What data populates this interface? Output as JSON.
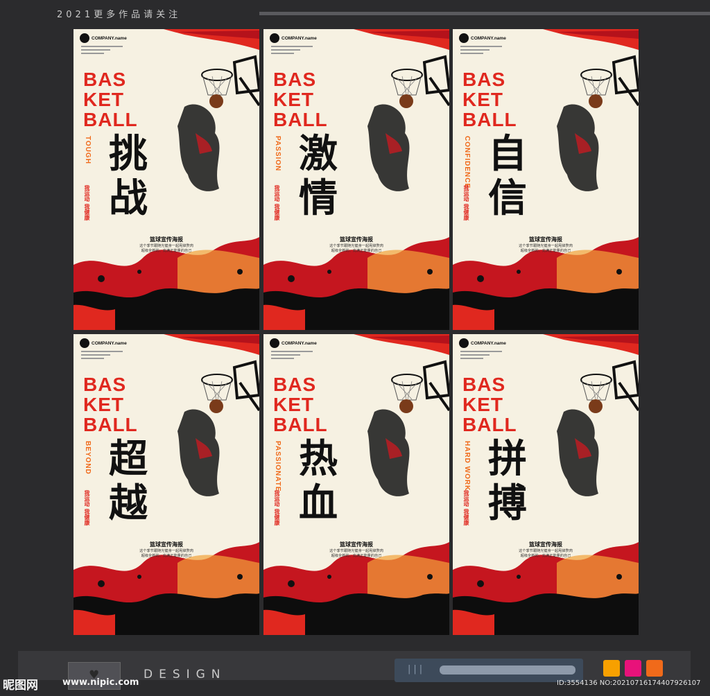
{
  "header": {
    "text": "2021更多作品请关注"
  },
  "brand": {
    "company": "COMPANY.name"
  },
  "posters": [
    {
      "big": [
        "BAS",
        "KET",
        "BALL"
      ],
      "vertical": "TOUGH",
      "chinese": "挑战",
      "vert_cn": "我运动 我健康",
      "subtitle": "篮球宣传海报",
      "desc1": "这个季节跟随光健身一起甩掉赘肉",
      "desc2": "超级全新的、充满正能量的自己"
    },
    {
      "big": [
        "BAS",
        "KET",
        "BALL"
      ],
      "vertical": "PASSION",
      "chinese": "激情",
      "vert_cn": "我运动 我健康",
      "subtitle": "篮球宣传海报",
      "desc1": "这个季节跟随光健身一起甩掉赘肉",
      "desc2": "超级全新的、充满正能量的自己"
    },
    {
      "big": [
        "BAS",
        "KET",
        "BALL"
      ],
      "vertical": "CONFIDENCE",
      "chinese": "自信",
      "vert_cn": "我运动 我健康",
      "subtitle": "篮球宣传海报",
      "desc1": "这个季节跟随光健身一起甩掉赘肉",
      "desc2": "超级全新的、充满正能量的自己"
    },
    {
      "big": [
        "BAS",
        "KET",
        "BALL"
      ],
      "vertical": "BEYOND",
      "chinese": "超越",
      "vert_cn": "我运动 我健康",
      "subtitle": "篮球宣传海报",
      "desc1": "这个季节跟随光健身一起甩掉赘肉",
      "desc2": "超级全新的、充满正能量的自己"
    },
    {
      "big": [
        "BAS",
        "KET",
        "BALL"
      ],
      "vertical": "PASSIONATE",
      "chinese": "热血",
      "vert_cn": "我运动 我健康",
      "subtitle": "篮球宣传海报",
      "desc1": "这个季节跟随光健身一起甩掉赘肉",
      "desc2": "超级全新的、充满正能量的自己"
    },
    {
      "big": [
        "BAS",
        "KET",
        "BALL"
      ],
      "vertical": "HARD WORK",
      "chinese": "拼搏",
      "vert_cn": "我运动 我健康",
      "subtitle": "篮球宣传海报",
      "desc1": "这个季节跟随光健身一起甩掉赘肉",
      "desc2": "超级全新的、充满正能量的自己"
    }
  ],
  "footer": {
    "design": "DESIGN",
    "slider_ticks": "|||",
    "watermark": "昵图网",
    "url": "www.nipic.com",
    "id": "ID:3554136 NO:20210716174407926107"
  },
  "colors": {
    "red": "#e0281f",
    "orange": "#f06a1a",
    "sq1": "#f7a000",
    "sq2": "#e8127a",
    "sq3": "#f06a1a"
  }
}
